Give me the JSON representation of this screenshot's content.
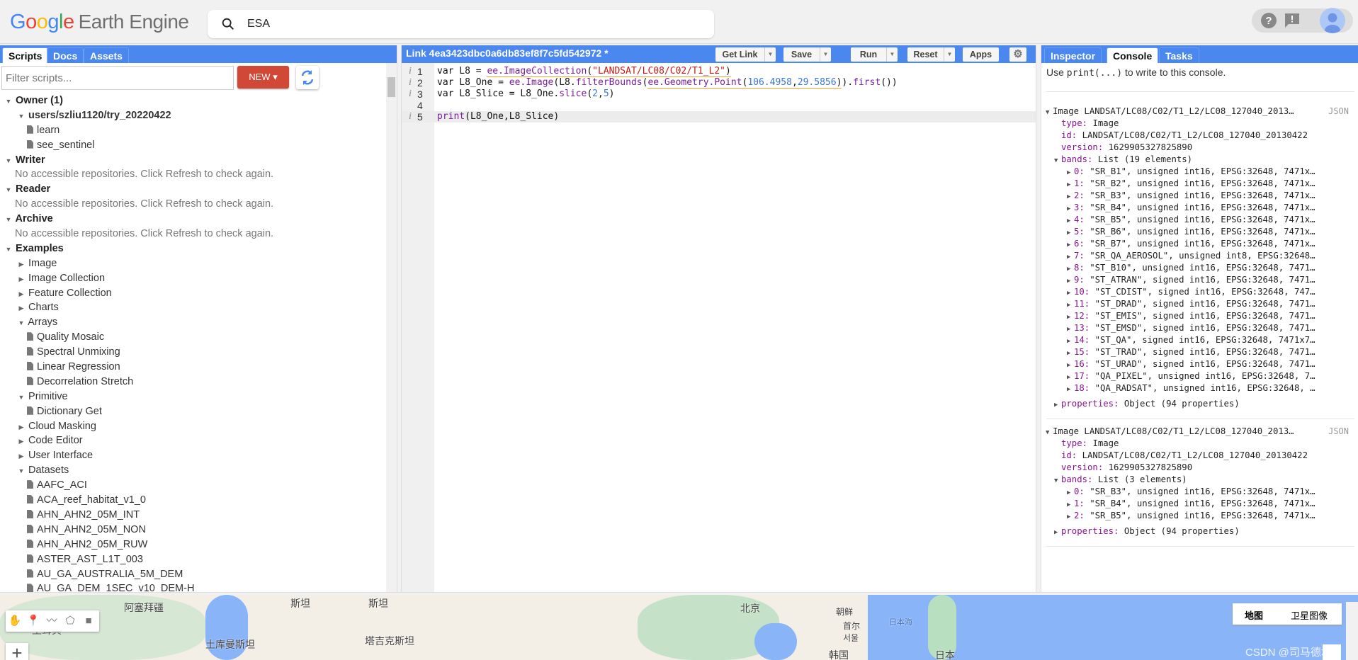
{
  "header": {
    "logo_google": [
      "G",
      "o",
      "o",
      "g",
      "l",
      "e"
    ],
    "logo_product": "Earth Engine",
    "search_value": "ESA",
    "icons": [
      "search-icon",
      "help-icon",
      "feedback-icon",
      "avatar-icon"
    ]
  },
  "left": {
    "tabs": [
      "Scripts",
      "Docs",
      "Assets"
    ],
    "active_tab": "Scripts",
    "filter_placeholder": "Filter scripts...",
    "new_label": "NEW",
    "tree": [
      {
        "level": 0,
        "type": "section",
        "open": true,
        "label": "Owner (1)"
      },
      {
        "level": 1,
        "type": "folder",
        "open": true,
        "label": "users/szliu1120/try_20220422",
        "bold": true
      },
      {
        "level": 2,
        "type": "file",
        "label": "learn"
      },
      {
        "level": 2,
        "type": "file",
        "label": "see_sentinel"
      },
      {
        "level": 0,
        "type": "section",
        "open": true,
        "label": "Writer"
      },
      {
        "level": 1,
        "type": "msg",
        "label": "No accessible repositories. Click Refresh to check again."
      },
      {
        "level": 0,
        "type": "section",
        "open": true,
        "label": "Reader"
      },
      {
        "level": 1,
        "type": "msg",
        "label": "No accessible repositories. Click Refresh to check again."
      },
      {
        "level": 0,
        "type": "section",
        "open": true,
        "label": "Archive"
      },
      {
        "level": 1,
        "type": "msg",
        "label": "No accessible repositories. Click Refresh to check again."
      },
      {
        "level": 0,
        "type": "section",
        "open": true,
        "label": "Examples"
      },
      {
        "level": 1,
        "type": "folder",
        "open": false,
        "label": "Image"
      },
      {
        "level": 1,
        "type": "folder",
        "open": false,
        "label": "Image Collection"
      },
      {
        "level": 1,
        "type": "folder",
        "open": false,
        "label": "Feature Collection"
      },
      {
        "level": 1,
        "type": "folder",
        "open": false,
        "label": "Charts"
      },
      {
        "level": 1,
        "type": "folder",
        "open": true,
        "label": "Arrays"
      },
      {
        "level": 2,
        "type": "file",
        "label": "Quality Mosaic"
      },
      {
        "level": 2,
        "type": "file",
        "label": "Spectral Unmixing"
      },
      {
        "level": 2,
        "type": "file",
        "label": "Linear Regression"
      },
      {
        "level": 2,
        "type": "file",
        "label": "Decorrelation Stretch"
      },
      {
        "level": 1,
        "type": "folder",
        "open": true,
        "label": "Primitive"
      },
      {
        "level": 2,
        "type": "file",
        "label": "Dictionary Get"
      },
      {
        "level": 1,
        "type": "folder",
        "open": false,
        "label": "Cloud Masking"
      },
      {
        "level": 1,
        "type": "folder",
        "open": false,
        "label": "Code Editor"
      },
      {
        "level": 1,
        "type": "folder",
        "open": false,
        "label": "User Interface"
      },
      {
        "level": 1,
        "type": "folder",
        "open": true,
        "label": "Datasets"
      },
      {
        "level": 2,
        "type": "file",
        "label": "AAFC_ACI"
      },
      {
        "level": 2,
        "type": "file",
        "label": "ACA_reef_habitat_v1_0"
      },
      {
        "level": 2,
        "type": "file",
        "label": "AHN_AHN2_05M_INT"
      },
      {
        "level": 2,
        "type": "file",
        "label": "AHN_AHN2_05M_NON"
      },
      {
        "level": 2,
        "type": "file",
        "label": "AHN_AHN2_05M_RUW"
      },
      {
        "level": 2,
        "type": "file",
        "label": "ASTER_AST_L1T_003"
      },
      {
        "level": 2,
        "type": "file",
        "label": "AU_GA_AUSTRALIA_5M_DEM"
      },
      {
        "level": 2,
        "type": "file",
        "label": "AU_GA_DEM_1SEC_v10_DEM-H"
      }
    ]
  },
  "editor": {
    "title": "Link 4ea3423dbc0a6db83ef8f7c5fd542972 *",
    "buttons": {
      "get_link": "Get Link",
      "save": "Save",
      "run": "Run",
      "reset": "Reset",
      "apps": "Apps"
    },
    "lines": [
      {
        "n": "1",
        "info": true,
        "tokens": [
          [
            "kw",
            "var L8 = "
          ],
          [
            "fn",
            "ee.ImageCollection",
            "ul"
          ],
          [
            "kw",
            "(",
            "ul"
          ],
          [
            "str",
            "\"LANDSAT/LC08/C02/T1_L2\"",
            "ul"
          ],
          [
            "kw",
            ")",
            "ul"
          ]
        ]
      },
      {
        "n": "2",
        "info": true,
        "tokens": [
          [
            "kw",
            "var L8_One = "
          ],
          [
            "fn",
            "ee.Image"
          ],
          [
            "kw",
            "(L8."
          ],
          [
            "fn",
            "filterBounds"
          ],
          [
            "kw",
            "("
          ],
          [
            "fn",
            "ee.Geometry.Point",
            "ul"
          ],
          [
            "kw",
            "(",
            "ul"
          ],
          [
            "num",
            "106.4958",
            "ul"
          ],
          [
            "kw",
            ",",
            "ul"
          ],
          [
            "num",
            "29.5856",
            "ul"
          ],
          [
            "kw",
            ")",
            "ul"
          ],
          [
            "kw",
            ")."
          ],
          [
            "fn",
            "first"
          ],
          [
            "kw",
            "())"
          ]
        ]
      },
      {
        "n": "3",
        "info": true,
        "tokens": [
          [
            "kw",
            "var L8_Slice = L8_One."
          ],
          [
            "fn",
            "slice"
          ],
          [
            "kw",
            "("
          ],
          [
            "num",
            "2"
          ],
          [
            "kw",
            ","
          ],
          [
            "num",
            "5"
          ],
          [
            "kw",
            ")"
          ]
        ]
      },
      {
        "n": "4",
        "info": false,
        "tokens": []
      },
      {
        "n": "5",
        "info": true,
        "active": true,
        "tokens": [
          [
            "fn",
            "print"
          ],
          [
            "kw",
            "(L8_One,L8_Slice)"
          ]
        ]
      }
    ]
  },
  "right": {
    "tabs": [
      "Inspector",
      "Console",
      "Tasks"
    ],
    "active_tab": "Console",
    "hint_pre": "Use ",
    "hint_code": "print(...)",
    "hint_post": " to write to this console.",
    "outputs": [
      {
        "title": "Image LANDSAT/LC08/C02/T1_L2/LC08_127040_2013…",
        "json_label": "JSON",
        "type": "Image",
        "id": "LANDSAT/LC08/C02/T1_L2/LC08_127040_20130422",
        "version": "1629905327825890",
        "bands_summary": "List (19 elements)",
        "bands": [
          [
            "0:",
            "\"SR_B1\", unsigned int16, EPSG:32648, 7471x…"
          ],
          [
            "1:",
            "\"SR_B2\", unsigned int16, EPSG:32648, 7471x…"
          ],
          [
            "2:",
            "\"SR_B3\", unsigned int16, EPSG:32648, 7471x…"
          ],
          [
            "3:",
            "\"SR_B4\", unsigned int16, EPSG:32648, 7471x…"
          ],
          [
            "4:",
            "\"SR_B5\", unsigned int16, EPSG:32648, 7471x…"
          ],
          [
            "5:",
            "\"SR_B6\", unsigned int16, EPSG:32648, 7471x…"
          ],
          [
            "6:",
            "\"SR_B7\", unsigned int16, EPSG:32648, 7471x…"
          ],
          [
            "7:",
            "\"SR_QA_AEROSOL\", unsigned int8, EPSG:32648…"
          ],
          [
            "8:",
            "\"ST_B10\", unsigned int16, EPSG:32648, 7471…"
          ],
          [
            "9:",
            "\"ST_ATRAN\", signed int16, EPSG:32648, 7471…"
          ],
          [
            "10:",
            "\"ST_CDIST\", signed int16, EPSG:32648, 747…"
          ],
          [
            "11:",
            "\"ST_DRAD\", signed int16, EPSG:32648, 7471…"
          ],
          [
            "12:",
            "\"ST_EMIS\", signed int16, EPSG:32648, 7471…"
          ],
          [
            "13:",
            "\"ST_EMSD\", signed int16, EPSG:32648, 7471…"
          ],
          [
            "14:",
            "\"ST_QA\", signed int16, EPSG:32648, 7471x7…"
          ],
          [
            "15:",
            "\"ST_TRAD\", signed int16, EPSG:32648, 7471…"
          ],
          [
            "16:",
            "\"ST_URAD\", signed int16, EPSG:32648, 7471…"
          ],
          [
            "17:",
            "\"QA_PIXEL\", unsigned int16, EPSG:32648, 7…"
          ],
          [
            "18:",
            "\"QA_RADSAT\", unsigned int16, EPSG:32648, …"
          ]
        ],
        "properties_summary": "Object (94 properties)"
      },
      {
        "title": "Image LANDSAT/LC08/C02/T1_L2/LC08_127040_2013…",
        "json_label": "JSON",
        "type": "Image",
        "id": "LANDSAT/LC08/C02/T1_L2/LC08_127040_20130422",
        "version": "1629905327825890",
        "bands_summary": "List (3 elements)",
        "bands": [
          [
            "0:",
            "\"SR_B3\", unsigned int16, EPSG:32648, 7471x…"
          ],
          [
            "1:",
            "\"SR_B4\", unsigned int16, EPSG:32648, 7471x…"
          ],
          [
            "2:",
            "\"SR_B5\", unsigned int16, EPSG:32648, 7471x…"
          ]
        ],
        "properties_summary": "Object (94 properties)"
      }
    ],
    "keys": {
      "type": "type:",
      "id": "id:",
      "version": "version:",
      "bands": "bands:",
      "properties": "properties:"
    }
  },
  "map": {
    "labels": [
      {
        "text": "阿塞拜疆"
      },
      {
        "text": "土耳其"
      },
      {
        "text": "土库曼斯坦"
      },
      {
        "text": "斯坦"
      },
      {
        "text": "斯坦"
      },
      {
        "text": "塔吉克斯坦"
      },
      {
        "text": "北京"
      },
      {
        "text": "朝鲜"
      },
      {
        "text": "首尔"
      },
      {
        "text": "서울"
      },
      {
        "text": "韩国"
      },
      {
        "text": "日本海"
      },
      {
        "text": "日本"
      }
    ],
    "map_type_options": [
      "地图",
      "卫星图像"
    ],
    "selected_map_type": "地图",
    "draw_tools": [
      "hand-icon",
      "marker-icon",
      "line-icon",
      "polygon-icon",
      "rectangle-icon"
    ],
    "zoom_in": "+",
    "watermark": "CSDN @司马德君"
  }
}
